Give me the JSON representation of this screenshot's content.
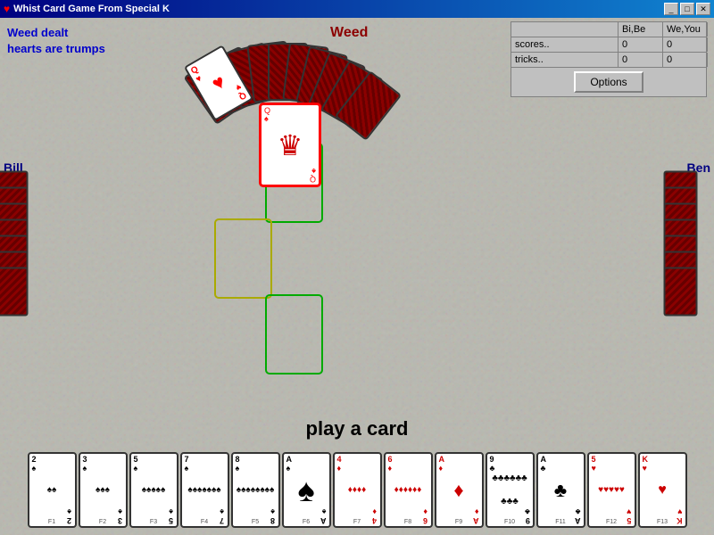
{
  "titlebar": {
    "text": "Whist Card Game From Special K",
    "heart": "♥"
  },
  "window_controls": {
    "minimize": "_",
    "maximize": "□",
    "close": "✕"
  },
  "status": {
    "line1": "Weed dealt",
    "line2": "hearts are trumps"
  },
  "scores": {
    "header": {
      "col1": "Bi,Be",
      "col2": "We,You"
    },
    "scores_label": "scores..",
    "tricks_label": "tricks..",
    "bi_be_score": "0",
    "we_you_score": "0",
    "bi_be_tricks": "0",
    "we_you_tricks": "0"
  },
  "options_btn": "Options",
  "players": {
    "top": "Weed",
    "left": "Bill",
    "right": "Ben"
  },
  "play_prompt": "play a card",
  "played_card": {
    "rank": "Q",
    "suit": "♠",
    "suit_name": "spades",
    "display": "Q"
  },
  "player_hand": [
    {
      "rank": "2",
      "suit": "♠",
      "color": "black",
      "fkey": "F1"
    },
    {
      "rank": "3",
      "suit": "♠",
      "color": "black",
      "fkey": "F2"
    },
    {
      "rank": "5",
      "suit": "♠",
      "color": "black",
      "fkey": "F3"
    },
    {
      "rank": "7",
      "suit": "♠",
      "color": "black",
      "fkey": "F4"
    },
    {
      "rank": "8",
      "suit": "♠",
      "color": "black",
      "fkey": "F5"
    },
    {
      "rank": "A",
      "suit": "♠",
      "color": "black",
      "fkey": "F6",
      "large": true
    },
    {
      "rank": "4",
      "suit": "♦",
      "color": "red",
      "fkey": "F7"
    },
    {
      "rank": "6",
      "suit": "♦",
      "color": "red",
      "fkey": "F8"
    },
    {
      "rank": "A",
      "suit": "♦",
      "color": "red",
      "fkey": "F9"
    },
    {
      "rank": "9",
      "suit": "♣",
      "color": "black",
      "fkey": "F10"
    },
    {
      "rank": "A",
      "suit": "♣",
      "color": "black",
      "fkey": "F11"
    },
    {
      "rank": "5",
      "suit": "♥",
      "color": "red",
      "fkey": "F12"
    },
    {
      "rank": "K",
      "suit": "♥",
      "color": "red",
      "fkey": "F13"
    }
  ]
}
